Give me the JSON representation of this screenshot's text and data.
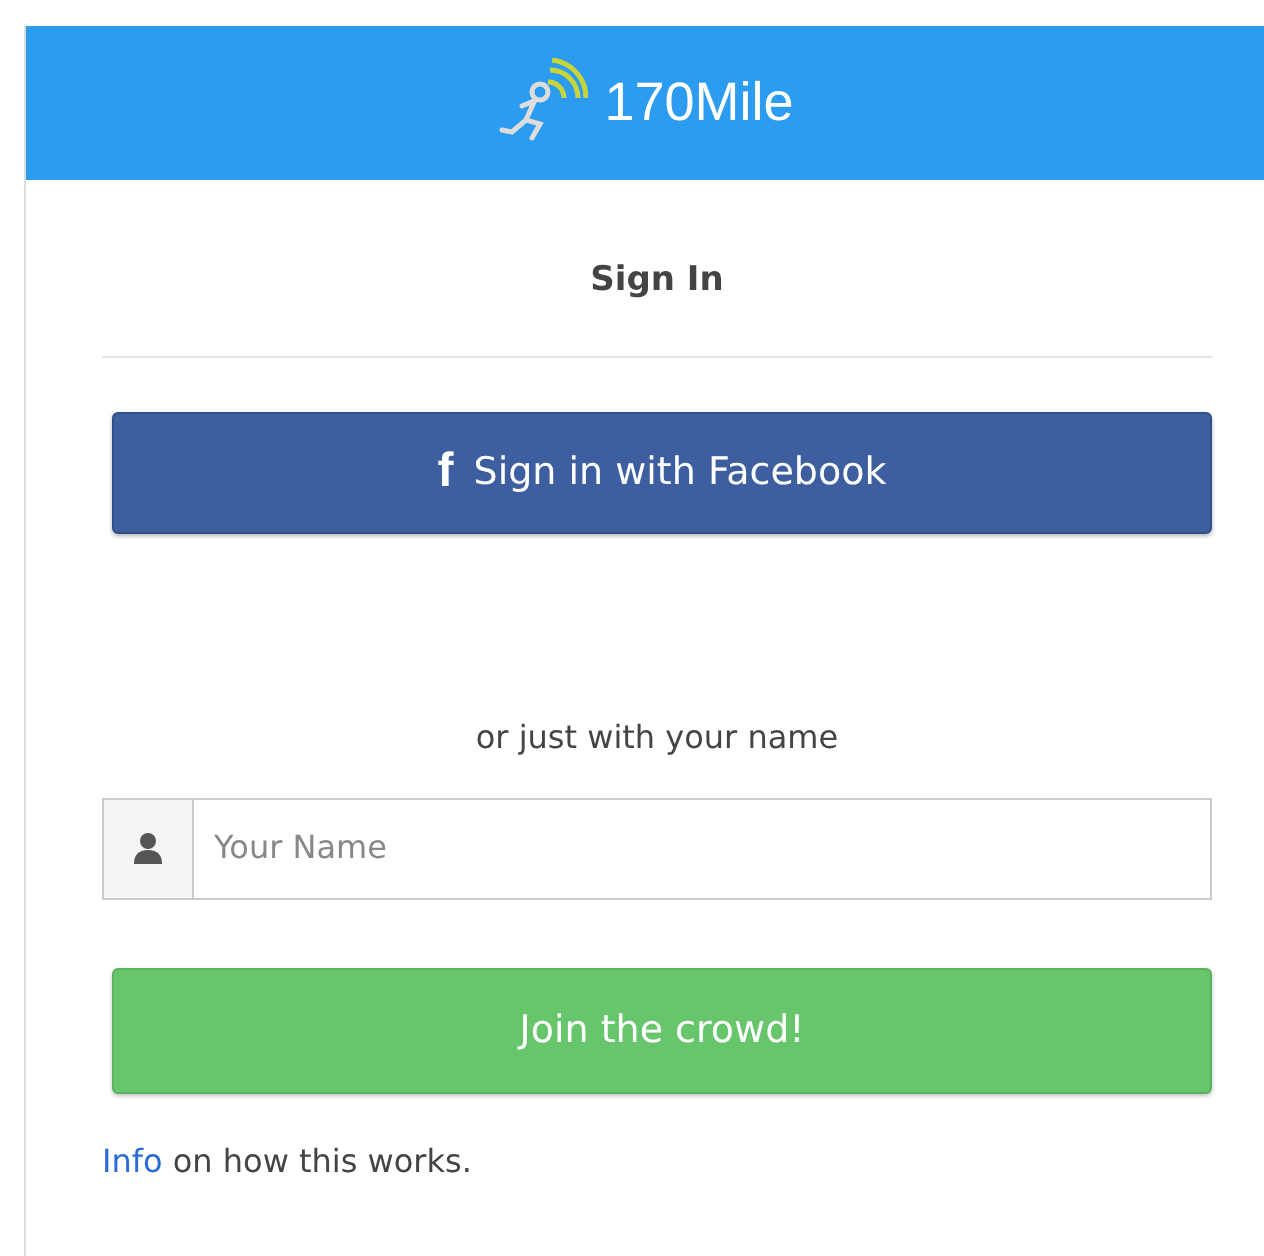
{
  "header": {
    "brand": "170Mile"
  },
  "title": "Sign In",
  "facebook_button": {
    "icon": "f",
    "label": "Sign in with Facebook"
  },
  "separator_text": "or just with your name",
  "name_field": {
    "placeholder": "Your Name"
  },
  "join_button": {
    "label": "Join the crowd!"
  },
  "info": {
    "link": "Info",
    "text": "on how this works."
  }
}
